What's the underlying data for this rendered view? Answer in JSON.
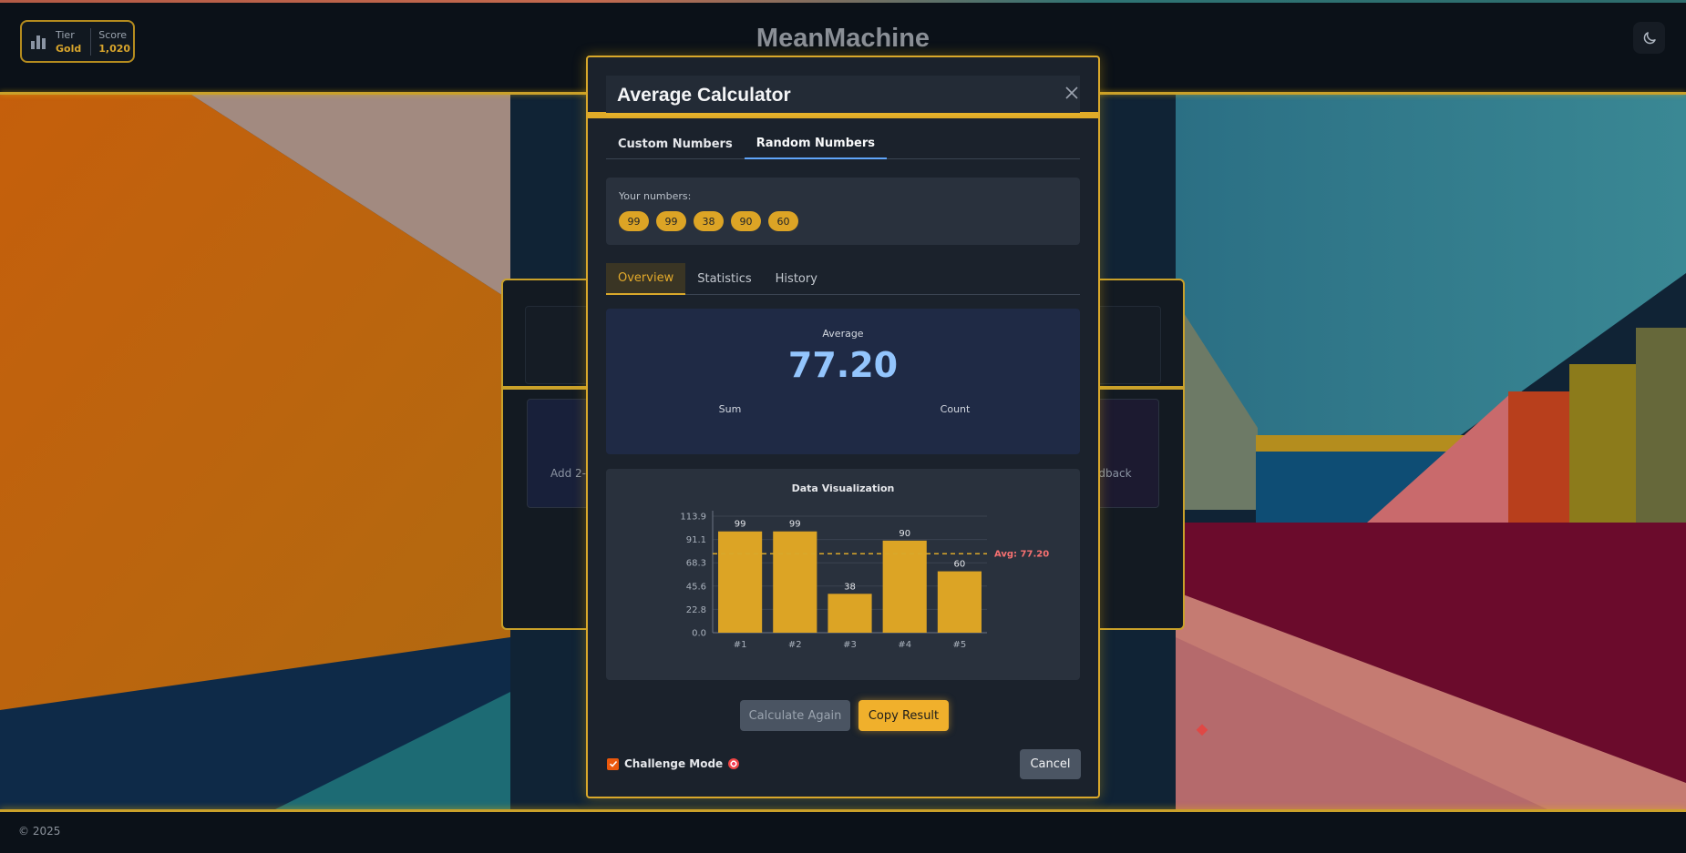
{
  "header": {
    "app_title": "MeanMachine",
    "tier_label": "Tier",
    "tier_value": "Gold",
    "score_label": "Score",
    "score_value": "1,020",
    "theme_icon": "moon-icon"
  },
  "background": {
    "tile_left_text": "Add 2-1",
    "tile_right_text": "edback"
  },
  "modal": {
    "title": "Average Calculator",
    "close_icon": "close-icon",
    "source_tabs": [
      {
        "label": "Custom Numbers",
        "active": false
      },
      {
        "label": "Random Numbers",
        "active": true
      }
    ],
    "numbers_label": "Your numbers:",
    "numbers": [
      "99",
      "99",
      "38",
      "90",
      "60"
    ],
    "view_tabs": [
      {
        "label": "Overview",
        "active": true
      },
      {
        "label": "Statistics",
        "active": false
      },
      {
        "label": "History",
        "active": false
      }
    ],
    "average_label": "Average",
    "average_value": "77.20",
    "sum_label": "Sum",
    "count_label": "Count",
    "viz_title": "Data Visualization",
    "calc_again_label": "Calculate Again",
    "copy_label": "Copy Result",
    "challenge_label": "Challenge Mode",
    "challenge_checked": true,
    "cancel_label": "Cancel"
  },
  "chart_data": {
    "type": "bar",
    "title": "Data Visualization",
    "categories": [
      "#1",
      "#2",
      "#3",
      "#4",
      "#5"
    ],
    "values": [
      99,
      99,
      38,
      90,
      60
    ],
    "data_labels": [
      "99",
      "99",
      "38",
      "90",
      "60"
    ],
    "y_ticks": [
      "0.0",
      "22.8",
      "45.6",
      "68.3",
      "91.1",
      "113.9"
    ],
    "ylim": [
      0,
      113.9
    ],
    "average_line": {
      "value": 77.2,
      "label": "Avg: 77.20"
    },
    "bar_color": "#dca425",
    "avg_line_color": "#d9a82b",
    "avg_label_color": "#f87171"
  },
  "footer": {
    "copyright": "© 2025"
  },
  "colors": {
    "accent": "#e0ab28",
    "primary_link": "#60a5fa",
    "avg_value": "#93c5fd"
  }
}
